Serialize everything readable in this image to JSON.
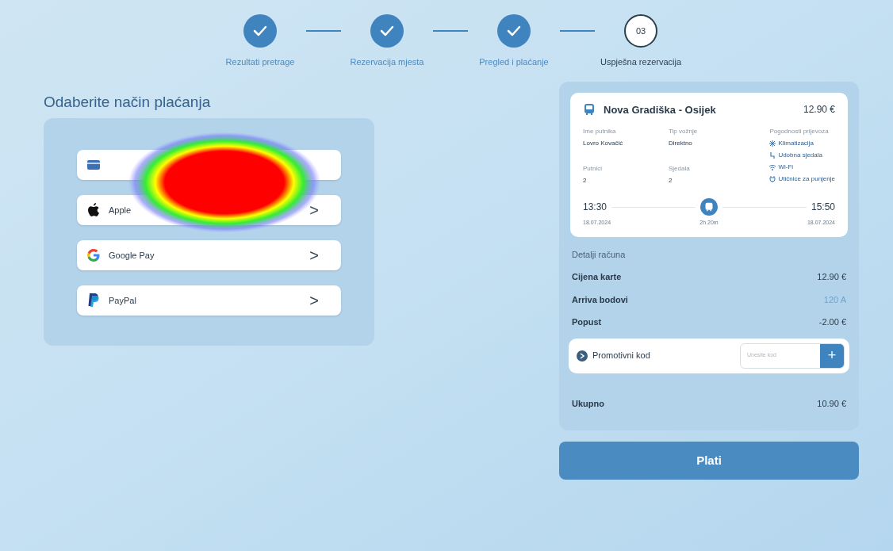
{
  "stepper": {
    "steps": [
      {
        "label": "Rezultati pretrage",
        "done": true
      },
      {
        "label": "Rezervacija mjesta",
        "done": true
      },
      {
        "label": "Pregled i plaćanje",
        "done": true
      },
      {
        "label": "Uspješna rezervacija",
        "done": false,
        "number": "03"
      }
    ]
  },
  "payment": {
    "title": "Odaberite način plaćanja",
    "methods": [
      {
        "kind": "card"
      },
      {
        "kind": "apple",
        "label": "Apple",
        "arrow": ">"
      },
      {
        "kind": "google",
        "label": "Google Pay",
        "arrow": ">"
      },
      {
        "kind": "paypal",
        "label": "PayPal",
        "arrow": ">"
      }
    ]
  },
  "heatmap": {
    "visible": true
  },
  "ticket": {
    "route": "Nova Gradiška - Osijek",
    "price": "12.90 €",
    "fields": [
      {
        "label": "Ime putnika",
        "value": "Lovro Kovačić"
      },
      {
        "label": "Tip vožnje",
        "value": "Direktno"
      },
      {
        "label": "Putnici",
        "value": "2"
      },
      {
        "label": "Sjedala",
        "value": "2"
      }
    ],
    "amenities_title": "Pogodnosti prijevoza",
    "amenities": [
      {
        "kind": "snow",
        "label": "Klimatizacija"
      },
      {
        "kind": "seat",
        "label": "Udobna sjedala"
      },
      {
        "kind": "wifi",
        "label": "Wi-Fi"
      },
      {
        "kind": "plug",
        "label": "Utičnice za punjenje"
      }
    ],
    "departure_time": "13:30",
    "departure_date": "18.07.2024",
    "duration": "2h 20m",
    "arrival_time": "15:50",
    "arrival_date": "18.07.2024"
  },
  "bill": {
    "title": "Detalji računa",
    "rows": [
      {
        "label": "Cijena karte",
        "value": "12.90 €",
        "muted": false
      },
      {
        "label": "Arriva bodovi",
        "value": "120 A",
        "muted": true
      },
      {
        "label": "Popust",
        "value": "-2.00 €",
        "muted": false
      }
    ],
    "promo": {
      "label": "Promotivni kod",
      "placeholder": "Unesite kod",
      "add": "+"
    },
    "total_label": "Ukupno",
    "total_value": "10.90 €"
  },
  "pay_button": "Plati"
}
